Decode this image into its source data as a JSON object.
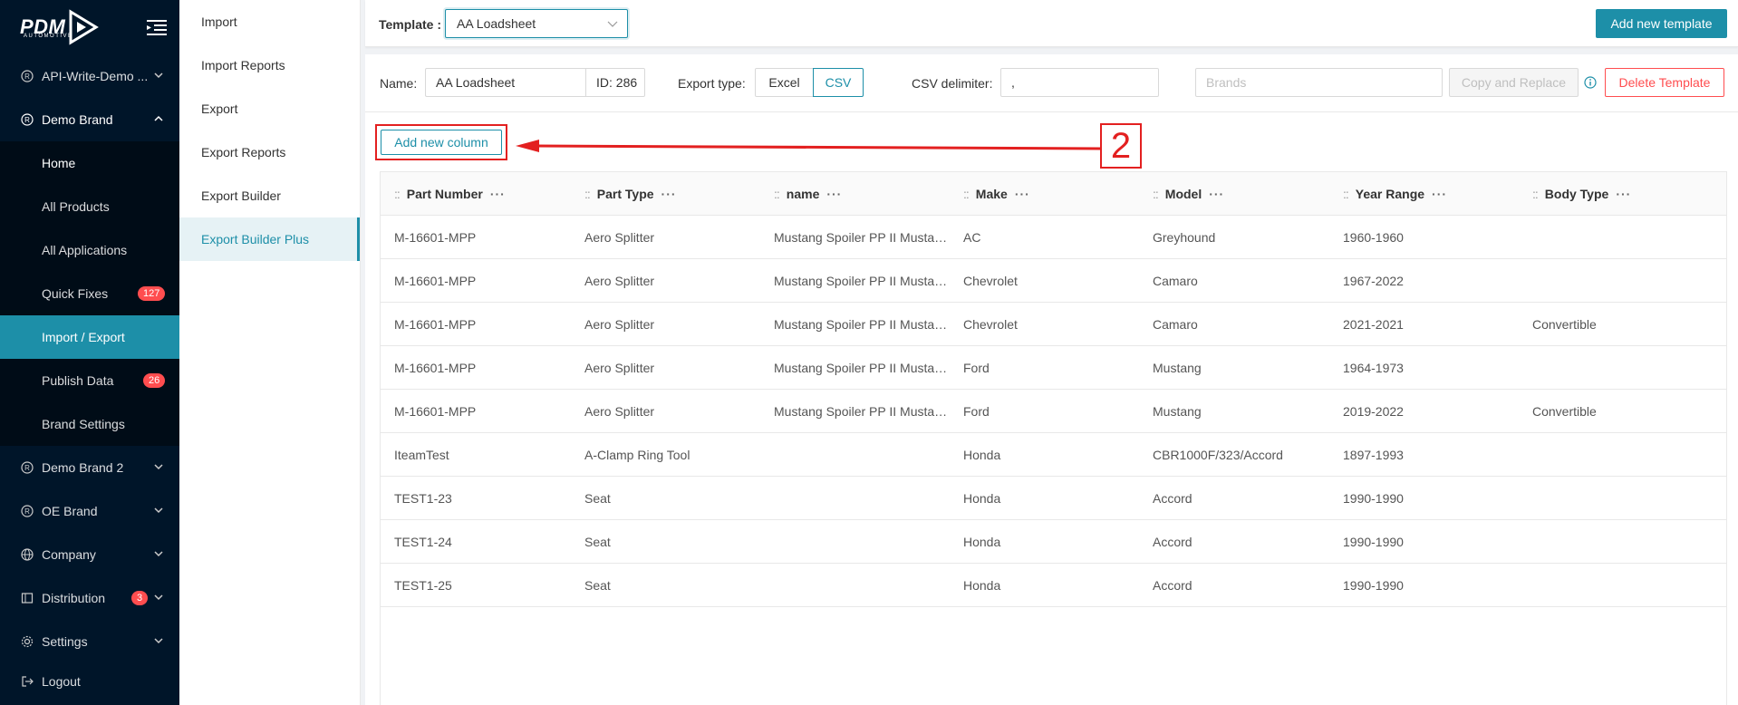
{
  "brand": {
    "logo_text": "PDM",
    "logo_sub": "AUTOMOTIVE"
  },
  "sidebar": {
    "items": [
      {
        "label": "API-Write-Demo ...",
        "icon": "registered-icon"
      },
      {
        "label": "Demo Brand",
        "icon": "registered-icon"
      },
      {
        "label": "Demo Brand 2",
        "icon": "registered-icon"
      },
      {
        "label": "OE Brand",
        "icon": "registered-icon"
      },
      {
        "label": "Company",
        "icon": "globe-icon"
      },
      {
        "label": "Distribution",
        "icon": "grid-icon",
        "badge": "3"
      },
      {
        "label": "Settings",
        "icon": "gear-icon"
      },
      {
        "label": "Logout",
        "icon": "logout-icon"
      }
    ],
    "sub": [
      {
        "label": "Home"
      },
      {
        "label": "All Products"
      },
      {
        "label": "All Applications"
      },
      {
        "label": "Quick Fixes",
        "badge": "127"
      },
      {
        "label": "Import / Export"
      },
      {
        "label": "Publish Data",
        "badge": "26"
      },
      {
        "label": "Brand Settings"
      }
    ]
  },
  "subnav": {
    "items": [
      "Import",
      "Import Reports",
      "Export",
      "Export Reports",
      "Export Builder",
      "Export Builder Plus"
    ]
  },
  "topbar": {
    "template_label": "Template :",
    "template_value": "AA Loadsheet",
    "add_template": "Add new template"
  },
  "toolbar": {
    "name_label": "Name:",
    "name_value": "AA Loadsheet",
    "id_text": "ID: 286",
    "export_type_label": "Export type:",
    "type_excel": "Excel",
    "type_csv": "CSV",
    "csv_delim_label": "CSV delimiter:",
    "csv_delim_value": ",",
    "brands_placeholder": "Brands",
    "copy_replace": "Copy and Replace",
    "delete_template": "Delete Template"
  },
  "add_column_label": "Add new column",
  "step_number": "2",
  "colors": {
    "accent": "#1d8fa8",
    "sidebar": "#001529",
    "danger": "#ff4d4f",
    "annotation": "#e32020"
  },
  "table": {
    "columns": [
      "Part Number",
      "Part Type",
      "name",
      "Make",
      "Model",
      "Year Range",
      "Body Type"
    ],
    "rows": [
      [
        "M-16601-MPP",
        "Aero Splitter",
        "Mustang Spoiler PP II Mustan...",
        "AC",
        "Greyhound",
        "1960-1960",
        ""
      ],
      [
        "M-16601-MPP",
        "Aero Splitter",
        "Mustang Spoiler PP II Mustan...",
        "Chevrolet",
        "Camaro",
        "1967-2022",
        ""
      ],
      [
        "M-16601-MPP",
        "Aero Splitter",
        "Mustang Spoiler PP II Mustan...",
        "Chevrolet",
        "Camaro",
        "2021-2021",
        "Convertible"
      ],
      [
        "M-16601-MPP",
        "Aero Splitter",
        "Mustang Spoiler PP II Mustan...",
        "Ford",
        "Mustang",
        "1964-1973",
        ""
      ],
      [
        "M-16601-MPP",
        "Aero Splitter",
        "Mustang Spoiler PP II Mustan...",
        "Ford",
        "Mustang",
        "2019-2022",
        "Convertible"
      ],
      [
        "IteamTest",
        "A-Clamp Ring Tool",
        "",
        "Honda",
        "CBR1000F/323/Accord",
        "1897-1993",
        ""
      ],
      [
        "TEST1-23",
        "Seat",
        "",
        "Honda",
        "Accord",
        "1990-1990",
        ""
      ],
      [
        "TEST1-24",
        "Seat",
        "",
        "Honda",
        "Accord",
        "1990-1990",
        ""
      ],
      [
        "TEST1-25",
        "Seat",
        "",
        "Honda",
        "Accord",
        "1990-1990",
        ""
      ]
    ]
  }
}
